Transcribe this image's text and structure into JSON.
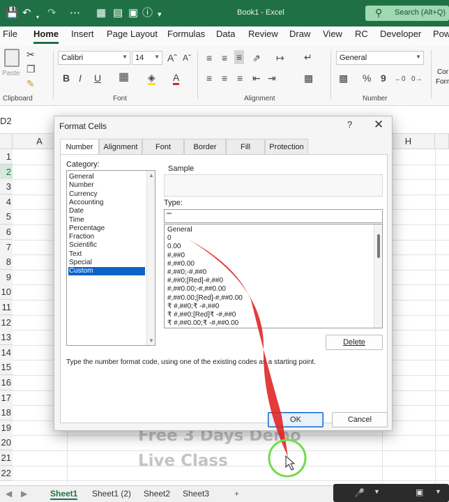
{
  "titlebar": {
    "title": "Book1  -  Excel",
    "search_placeholder": "Search (Alt+Q)",
    "qa_icons": [
      "save-icon",
      "undo-icon",
      "redo-icon",
      "borders-icon",
      "form-icon",
      "table-icon",
      "camera-icon",
      "help-icon"
    ]
  },
  "menu": {
    "tabs": [
      "File",
      "Home",
      "Insert",
      "Page Layout",
      "Formulas",
      "Data",
      "Review",
      "Draw",
      "View",
      "RC",
      "Developer",
      "Pow"
    ],
    "active": "Home"
  },
  "ribbon": {
    "clipboard_label": "Clipboard",
    "paste_label": "Paste",
    "font_label": "Font",
    "font_name": "Calibri",
    "font_size": "14",
    "alignment_label": "Alignment",
    "number_label": "Number",
    "number_format": "General",
    "cond_label_1": "Cor",
    "cond_label_2": "Form",
    "bold": "B",
    "italic": "I",
    "underline": "U",
    "grow": "Aˆ",
    "shrink": "Aˇ",
    "percent": "%",
    "comma": "9"
  },
  "formula_bar": {
    "name_box": "D2"
  },
  "grid": {
    "columns": [
      "A",
      "H"
    ],
    "rows": [
      "1",
      "2",
      "3",
      "4",
      "5",
      "6",
      "7",
      "8",
      "9",
      "10",
      "11",
      "12",
      "13",
      "14",
      "15",
      "16",
      "17",
      "18",
      "19",
      "20",
      "21",
      "22"
    ],
    "selected_row": "2",
    "watermark_line1": "Free 3 Days Demo",
    "watermark_line2": "Live Class"
  },
  "sheet_tabs": {
    "tabs": [
      "Sheet1",
      "Sheet1 (2)",
      "Sheet2",
      "Sheet3"
    ],
    "active": "Sheet1",
    "add": "+"
  },
  "dialog": {
    "title": "Format Cells",
    "help": "?",
    "close": "✕",
    "tabs": [
      "Number",
      "Alignment",
      "Font",
      "Border",
      "Fill",
      "Protection"
    ],
    "active_tab": "Number",
    "category_label": "Category:",
    "categories": [
      "General",
      "Number",
      "Currency",
      "Accounting",
      "Date",
      "Time",
      "Percentage",
      "Fraction",
      "Scientific",
      "Text",
      "Special",
      "Custom"
    ],
    "selected_category": "Custom",
    "sample_label": "Sample",
    "type_label": "Type:",
    "type_value": "\"\"",
    "formats": [
      "General",
      "0",
      "0.00",
      "#,##0",
      "#,##0.00",
      "#,##0;-#,##0",
      "#,##0;[Red]-#,##0",
      "#,##0.00;-#,##0.00",
      "#,##0.00;[Red]-#,##0.00",
      "₹ #,##0;₹ -#,##0",
      "₹ #,##0;[Red]₹ -#,##0",
      "₹ #,##0.00;₹ -#,##0.00"
    ],
    "delete_label": "Delete",
    "hint": "Type the number format code, using one of the existing codes as a starting point.",
    "ok_label": "OK",
    "cancel_label": "Cancel"
  },
  "colors": {
    "excel_green": "#1f7145",
    "selection_blue": "#0a63c9",
    "annotation_red": "#e02020",
    "annotation_green": "#6fdc4a"
  }
}
